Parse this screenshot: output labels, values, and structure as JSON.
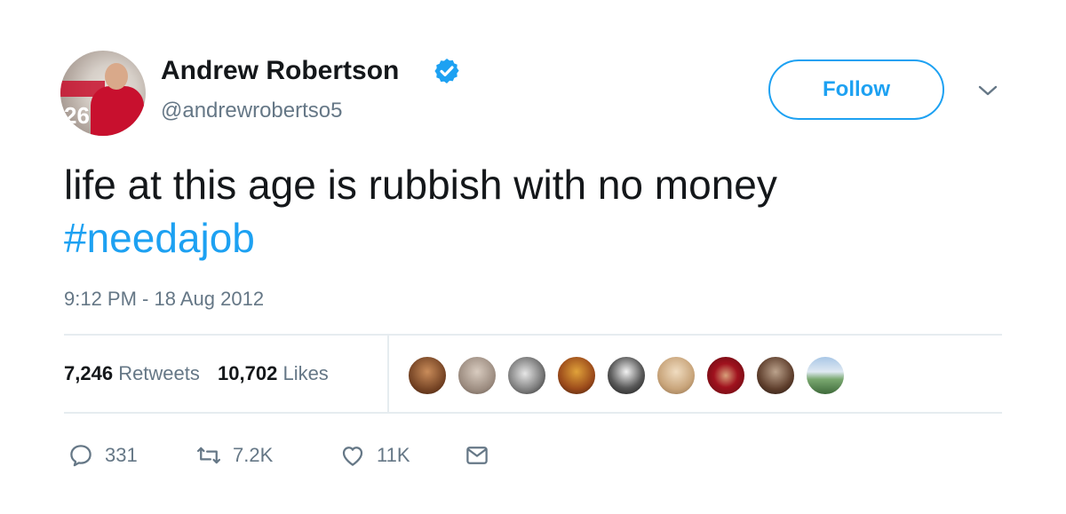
{
  "user": {
    "name": "Andrew Robertson",
    "handle": "@andrewrobertso5",
    "avatar_number": "26",
    "verified": true
  },
  "follow_button": {
    "label": "Follow"
  },
  "tweet": {
    "text": "life at this age is rubbish with no money",
    "hashtag": "#needajob",
    "timestamp": "9:12 PM - 18 Aug 2012"
  },
  "stats": {
    "retweets_count": "7,246",
    "retweets_label": "Retweets",
    "likes_count": "10,702",
    "likes_label": "Likes"
  },
  "liker_avatars": 9,
  "actions": {
    "reply_count": "331",
    "retweet_count": "7.2K",
    "like_count": "11K"
  },
  "colors": {
    "accent": "#1da1f2",
    "text_primary": "#14171a",
    "text_secondary": "#657786",
    "divider": "#e6ecf0"
  },
  "icons": {
    "verified": "verified-badge-icon",
    "caret": "chevron-down-icon",
    "reply": "reply-icon",
    "retweet": "retweet-icon",
    "like": "heart-icon",
    "dm": "envelope-icon"
  }
}
